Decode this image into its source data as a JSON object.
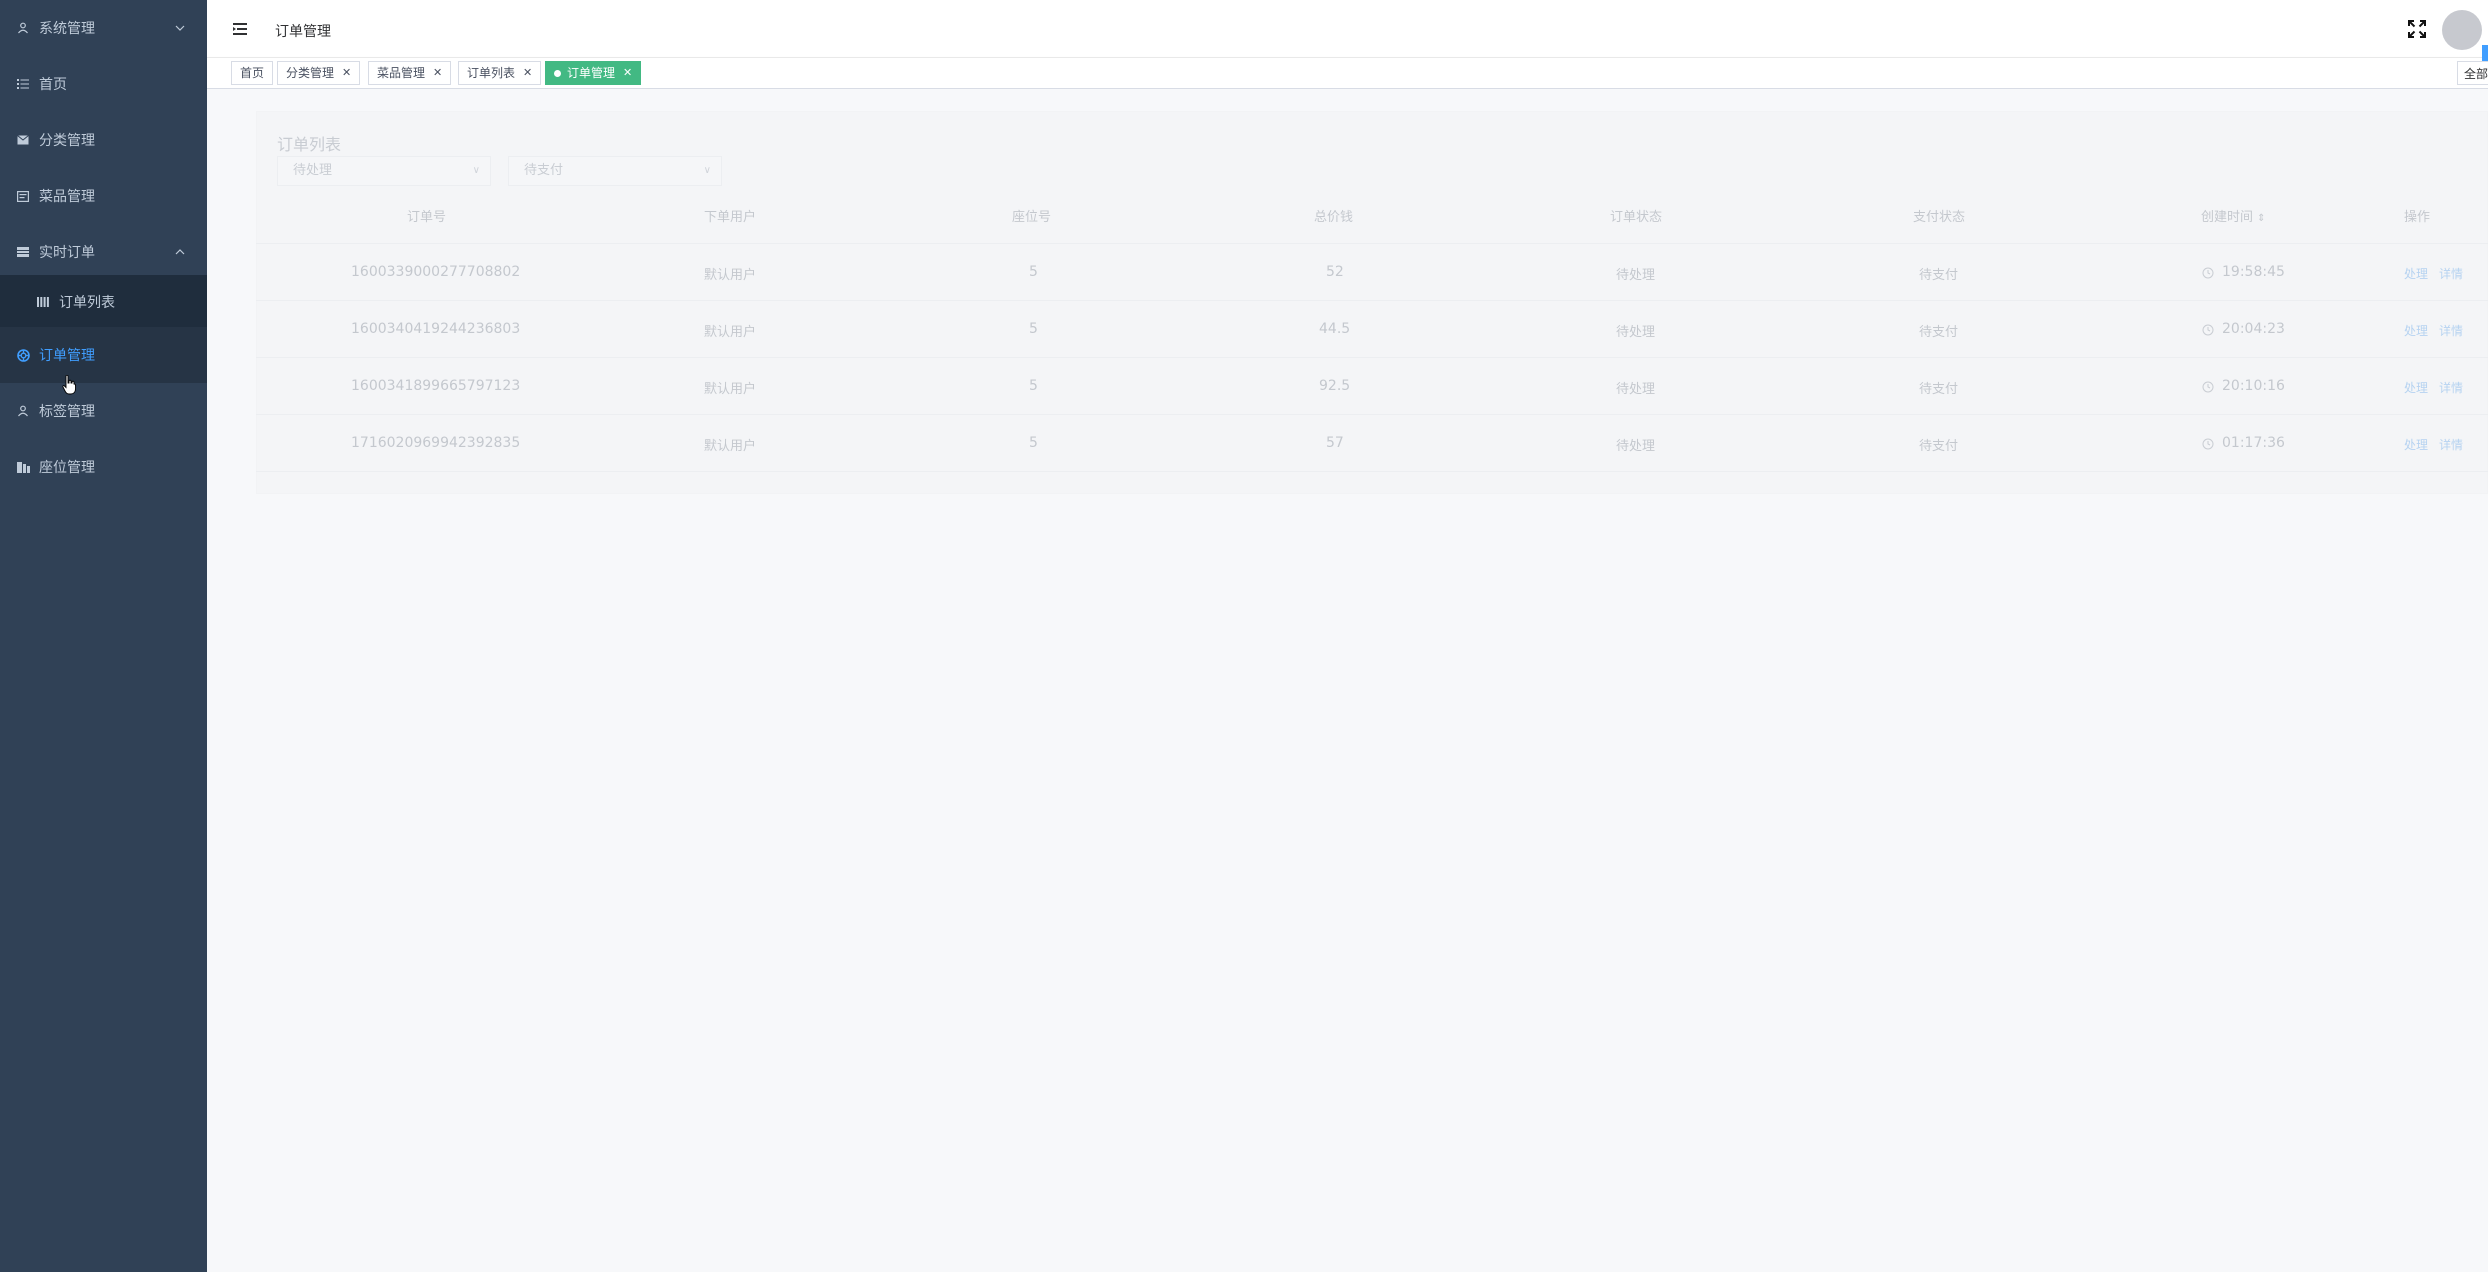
{
  "sidebar": {
    "items": [
      {
        "label": "系统管理",
        "icon": "user-icon"
      },
      {
        "label": "首页",
        "icon": "list-icon"
      },
      {
        "label": "分类管理",
        "icon": "mail-icon"
      },
      {
        "label": "菜品管理",
        "icon": "picture-icon"
      },
      {
        "label": "实时订单",
        "icon": "menu-icon"
      },
      {
        "label": "订单列表",
        "icon": "grid-icon"
      },
      {
        "label": "订单管理",
        "icon": "help-icon"
      },
      {
        "label": "标签管理",
        "icon": "user-icon"
      },
      {
        "label": "座位管理",
        "icon": "seat-icon"
      }
    ]
  },
  "navbar": {
    "title": "订单管理"
  },
  "tags": [
    {
      "label": "首页"
    },
    {
      "label": "分类管理"
    },
    {
      "label": "菜品管理"
    },
    {
      "label": "订单列表"
    },
    {
      "label": "订单管理"
    }
  ],
  "tags_right_label": "全部",
  "main": {
    "card_title": "订单列表",
    "filters": [
      {
        "value": "待处理"
      },
      {
        "value": "待支付"
      }
    ],
    "columns": [
      "订单号",
      "下单用户",
      "座位号",
      "总价钱",
      "订单状态",
      "支付状态",
      "创建时间",
      "操作"
    ],
    "rows": [
      {
        "order_no": "1600339000277708802",
        "user": "默认用户",
        "seat": "5",
        "total": "52",
        "status": "待处理",
        "pay": "待支付",
        "time": "19:58:45"
      },
      {
        "order_no": "1600340419244236803",
        "user": "默认用户",
        "seat": "5",
        "total": "44.5",
        "status": "待处理",
        "pay": "待支付",
        "time": "20:04:23"
      },
      {
        "order_no": "1600341899665797123",
        "user": "默认用户",
        "seat": "5",
        "total": "92.5",
        "status": "待处理",
        "pay": "待支付",
        "time": "20:10:16"
      },
      {
        "order_no": "1716020969942392835",
        "user": "默认用户",
        "seat": "5",
        "total": "57",
        "status": "待处理",
        "pay": "待支付",
        "time": "01:17:36"
      }
    ],
    "action_process": "处理",
    "action_detail": "详情"
  },
  "colors": {
    "sidebar_bg": "#304156",
    "sidebar_text": "#bfcbd9",
    "active_menu": "#409eff",
    "active_tag": "#42b983"
  }
}
